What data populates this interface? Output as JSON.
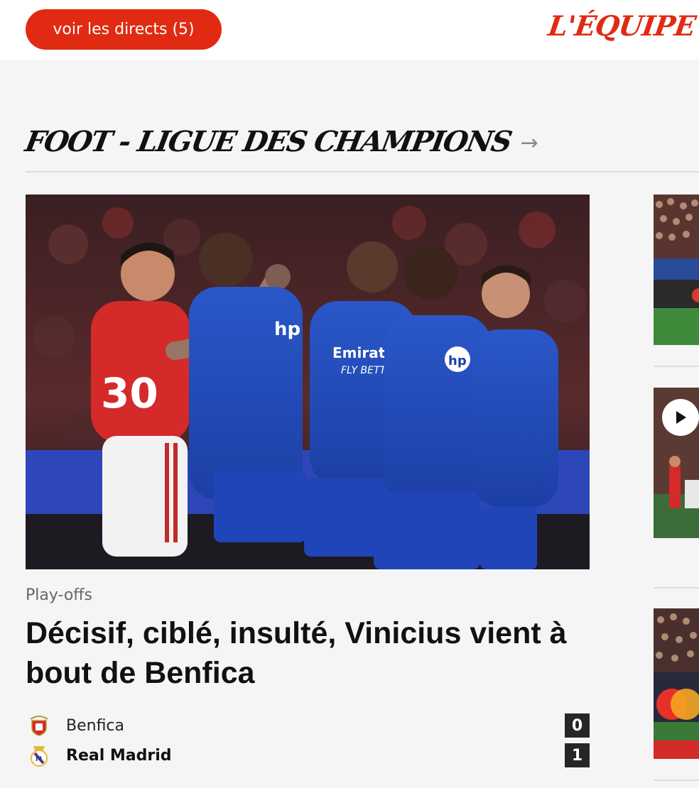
{
  "header": {
    "live_button_label": "voir les directs (5)",
    "logo_text": "L'ÉQUIPE",
    "brand_color": "#e02b12"
  },
  "section": {
    "title": "FOOT - LIGUE DES CHAMPIONS",
    "arrow_icon": "arrow-right-icon"
  },
  "article": {
    "kicker": "Play-offs",
    "headline": "Décisif, ciblé, insulté, Vinicius vient à bout de Benfica",
    "image_description_icon": "photo"
  },
  "match": {
    "teams": [
      {
        "name": "Benfica",
        "score": "0",
        "winner": false,
        "crest_icon": "benfica-crest-icon"
      },
      {
        "name": "Real Madrid",
        "score": "1",
        "winner": true,
        "crest_icon": "real-madrid-crest-icon"
      }
    ]
  },
  "sidebar": {
    "thumbnails": [
      {
        "kind": "image"
      },
      {
        "kind": "video",
        "icon": "play-icon"
      },
      {
        "kind": "image"
      }
    ]
  }
}
